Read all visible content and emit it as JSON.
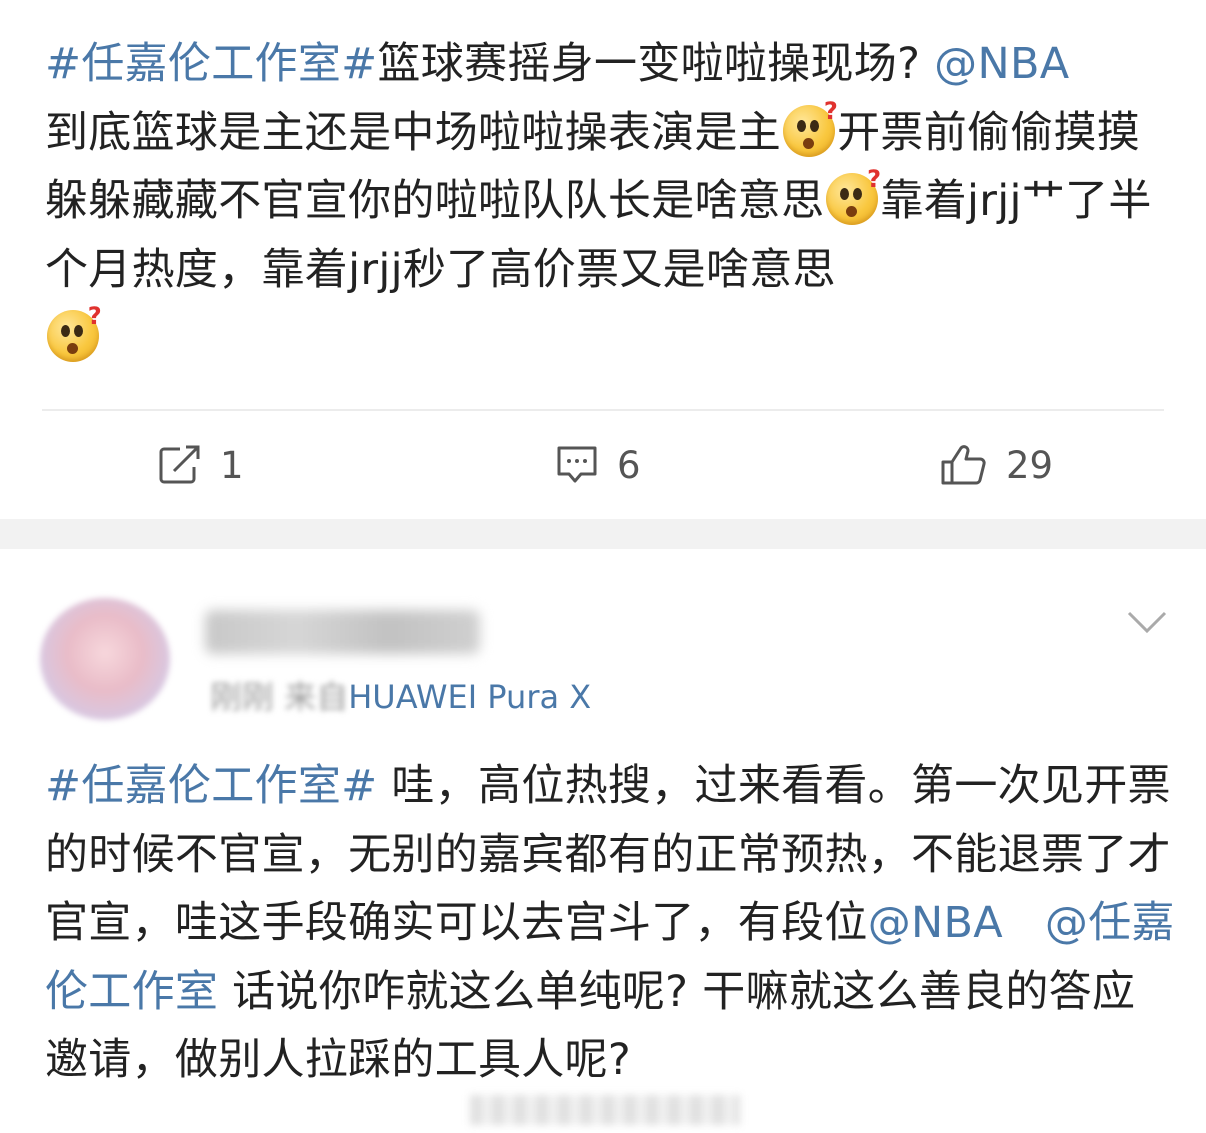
{
  "post": {
    "hashtag": "#任嘉伦工作室#",
    "text1": "篮球赛摇身一变啦啦操现场? ",
    "mention": "@NBA",
    "text2": "到底篮球是主还是中场啦啦操表演是主",
    "text3": "开票前偷偷摸摸躲躲藏藏不官宣你的啦啦队队长是啥意思",
    "text4": "靠着jrjj艹了半个月热度，靠着jrjj秒了高价票又是啥意思",
    "emoji_name": "confused-question-emoji"
  },
  "actions": {
    "repost_count": "1",
    "comment_count": "6",
    "like_count": "29"
  },
  "comment": {
    "username": "​",
    "time": "刚刚",
    "from_label": "来自",
    "device": "HUAWEI Pura X",
    "hashtag": "#任嘉伦工作室#",
    "text1": " 哇，高位热搜，过来看看。第一次见开票的时候不官宣，无别的嘉宾都有的正常预热，不能退票了才官宣，哇这手段确实可以去宫斗了，有段位",
    "mention1": "@NBA",
    "mention2": "@任嘉伦工作室",
    "text2": " 话说你咋就这么单纯呢? 干嘛就这么善良的答应邀请，做别人拉踩的工具人呢?"
  },
  "colors": {
    "link": "#4a78a8",
    "text": "#222222",
    "separator": "#f2f2f2"
  }
}
